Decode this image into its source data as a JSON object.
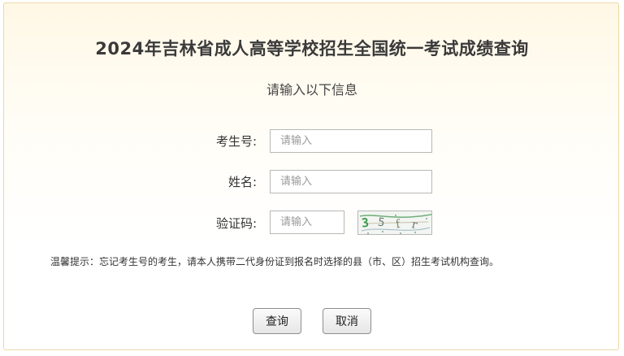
{
  "page": {
    "title": "2024年吉林省成人高等学校招生全国统一考试成绩查询",
    "subtitle": "请输入以下信息"
  },
  "form": {
    "exam_number": {
      "label": "考生号:",
      "value": "",
      "placeholder": "请输入"
    },
    "name": {
      "label": "姓名:",
      "value": "",
      "placeholder": "请输入"
    },
    "captcha": {
      "label": "验证码:",
      "value": "",
      "placeholder": "请输入",
      "image_text": "3 5 f r"
    }
  },
  "tip": "温馨提示：忘记考生号的考生，请本人携带二代身份证到报名时选择的县（市、区）招生考试机构查询。",
  "buttons": {
    "query": "查询",
    "cancel": "取消"
  },
  "colors": {
    "panel_border": "#ecd9a6",
    "panel_gradient_top": "#fff8e6",
    "captcha_glyph_green": "#3e9a50",
    "captcha_glyph_gray": "#6d7a74"
  }
}
